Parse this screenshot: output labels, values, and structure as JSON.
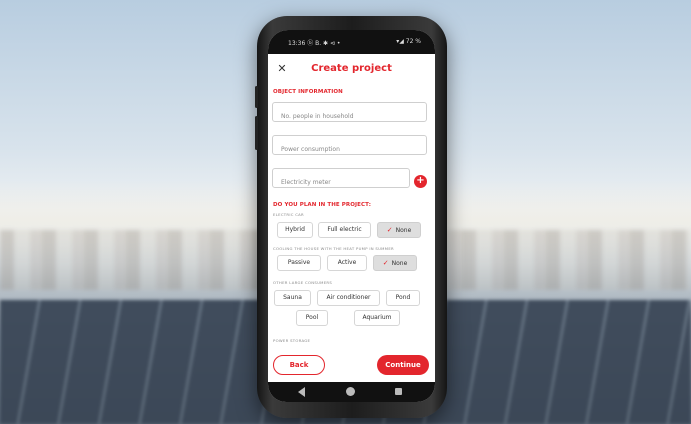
{
  "status_bar": {
    "time": "13:36 ⓑ B. ✱ ⊲ •",
    "right": "▾◢ 72 %"
  },
  "header": {
    "title": "Create project",
    "close_icon": "close-icon"
  },
  "object_info": {
    "title": "OBJECT INFORMATION",
    "people_placeholder": "No. people in household",
    "power_placeholder": "Power consumption",
    "meter_placeholder": "Electricity meter",
    "add_label": "+"
  },
  "plan": {
    "title": "DO YOU PLAN IN THE PROJECT:",
    "electric_car": {
      "label": "ELECTRIC CAR",
      "options": [
        "Hybrid",
        "Full electric",
        "None"
      ],
      "selected": "None"
    },
    "cooling": {
      "label": "COOLING THE HOUSE WITH THE HEAT PUMP IN SUMMER",
      "options": [
        "Passive",
        "Active",
        "None"
      ],
      "selected": "None"
    },
    "consumers": {
      "label": "OTHER LARGE CONSUMERS",
      "options": [
        "Sauna",
        "Air conditioner",
        "Pond",
        "Pool",
        "Aquarium"
      ]
    },
    "next_label": "POWER STORAGE"
  },
  "footer": {
    "back_label": "Back",
    "continue_label": "Continue"
  },
  "colors": {
    "accent": "#e3262d",
    "selected_chip": "#dedede"
  }
}
